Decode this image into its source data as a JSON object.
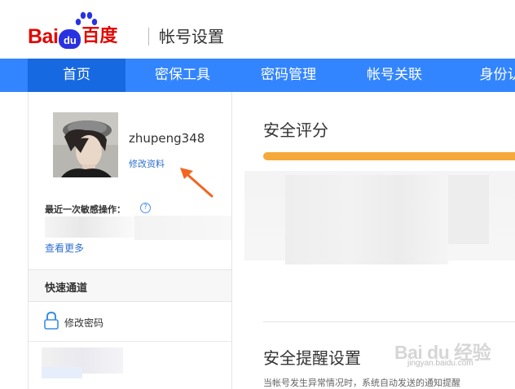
{
  "header": {
    "logo_text_bai": "Bai",
    "logo_text_du": "du",
    "logo_text_cn": "百度",
    "page_title": "帐号设置"
  },
  "nav": {
    "active_color": "#1669e0",
    "bar_color": "#3385ff",
    "tabs": [
      {
        "label": "首页"
      },
      {
        "label": "密保工具"
      },
      {
        "label": "密码管理"
      },
      {
        "label": "帐号关联"
      },
      {
        "label": "身份认"
      }
    ]
  },
  "sidebar": {
    "username": "zhupeng348",
    "edit_profile": "修改资料",
    "last_operation_label": "最近一次敏感操作：",
    "help_icon_glyph": "?",
    "view_more": "查看更多",
    "quick_access_title": "快速通道",
    "change_password": "修改密码"
  },
  "main": {
    "security_score_title": "安全评分",
    "security_alert_title": "安全提醒设置",
    "security_alert_desc": "当帐号发生异常情况时，系统自动发送的通知提醒",
    "score_bar_color": "#f5a93a"
  },
  "watermark": {
    "text": "Bai du 经验",
    "sub": "jingyan.baidu.com"
  },
  "icons": {
    "paw": "baidu-paw-icon",
    "help": "help-icon",
    "lock": "lock-icon",
    "arrow": "annotation-arrow-icon"
  }
}
